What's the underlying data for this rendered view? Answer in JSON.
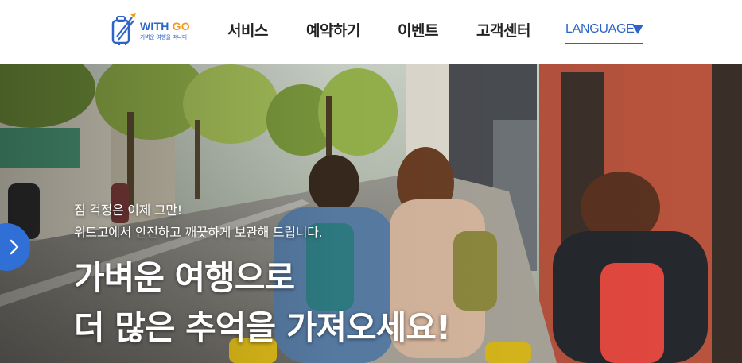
{
  "logo": {
    "name_part1": "WITH",
    "name_part2": "GO",
    "tagline": "가벼운 여행을 떠나다",
    "icon": "suitcase-logo-icon",
    "colors": {
      "primary": "#2e64c8",
      "accent": "#f29a1a"
    }
  },
  "nav": {
    "items": [
      {
        "label": "서비스"
      },
      {
        "label": "예약하기"
      },
      {
        "label": "이벤트"
      },
      {
        "label": "고객센터"
      }
    ]
  },
  "language": {
    "label": "LANGUAGE",
    "icon": "caret-down-icon",
    "color": "#2e64c8"
  },
  "hero": {
    "subtitle_line1": "짐 걱정은 이제 그만!",
    "subtitle_line2": "위드고에서 안전하고 깨끗하게 보관해 드립니다.",
    "title_line1": "가벼운 여행으로",
    "title_line2": "더 많은 추억을 가져오세요!",
    "prev_icon": "chevron-left-icon",
    "prev_button_color": "#2f6fd6"
  }
}
